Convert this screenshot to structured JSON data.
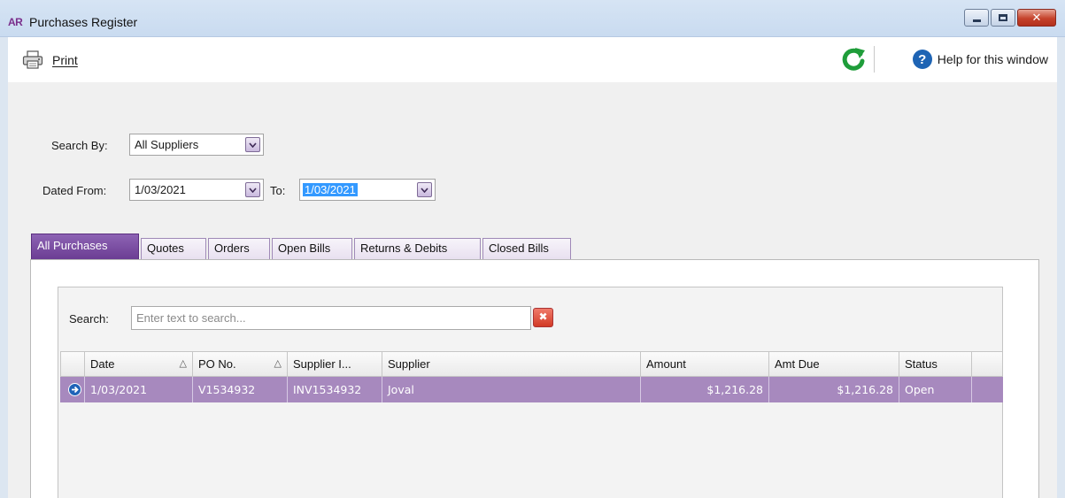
{
  "window": {
    "app_badge": "AR",
    "title": "Purchases Register"
  },
  "toolbar": {
    "print_label": "Print",
    "help_label": "Help for this window"
  },
  "filters": {
    "search_by_label": "Search By:",
    "search_by_value": "All Suppliers",
    "dated_from_label": "Dated From:",
    "dated_from_value": "1/03/2021",
    "to_label": "To:",
    "to_value": "1/03/2021"
  },
  "tabs": [
    {
      "label": "All Purchases",
      "active": true
    },
    {
      "label": "Quotes",
      "active": false
    },
    {
      "label": "Orders",
      "active": false
    },
    {
      "label": "Open Bills",
      "active": false
    },
    {
      "label": "Returns & Debits",
      "active": false
    },
    {
      "label": "Closed Bills",
      "active": false
    }
  ],
  "search": {
    "label": "Search:",
    "placeholder": "Enter text to search..."
  },
  "grid": {
    "columns": [
      "Date",
      "PO No.",
      "Supplier I...",
      "Supplier",
      "Amount",
      "Amt Due",
      "Status"
    ],
    "sort_glyph": "△",
    "rows": [
      {
        "date": "1/03/2021",
        "po_no": "V1534932",
        "supplier_invoice": "INV1534932",
        "supplier": "Joval",
        "amount": "$1,216.28",
        "amt_due": "$1,216.28",
        "status": "Open"
      }
    ]
  },
  "colors": {
    "accent_purple": "#6b3d93",
    "selected_row": "#a789be",
    "refresh_green": "#1f9d3a",
    "help_blue": "#1e64b4"
  }
}
